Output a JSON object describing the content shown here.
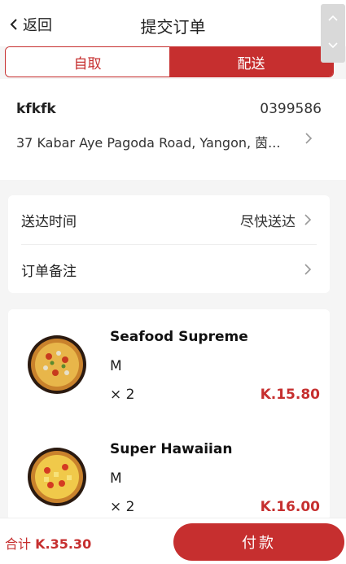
{
  "header": {
    "back_label": "返回",
    "title": "提交订单"
  },
  "tabs": [
    {
      "label": "自取",
      "active": false
    },
    {
      "label": "配送",
      "active": true
    }
  ],
  "address": {
    "name": "kfkfk",
    "phone": "0399586",
    "line": "37 Kabar Aye Pagoda Road, Yangon, 茵..."
  },
  "options": {
    "delivery_time": {
      "label": "送达时间",
      "value": "尽快送达"
    },
    "note": {
      "label": "订单备注"
    }
  },
  "items": [
    {
      "name": "Seafood Supreme",
      "size": "M",
      "qty": "× 2",
      "price": "K.15.80"
    },
    {
      "name": "Super Hawaiian",
      "size": "M",
      "qty": "× 2",
      "price": "K.16.00"
    }
  ],
  "footer": {
    "total_label": "合计",
    "total_amount": "K.35.30",
    "pay_label": "付款"
  },
  "colors": {
    "accent": "#c62f2f"
  }
}
